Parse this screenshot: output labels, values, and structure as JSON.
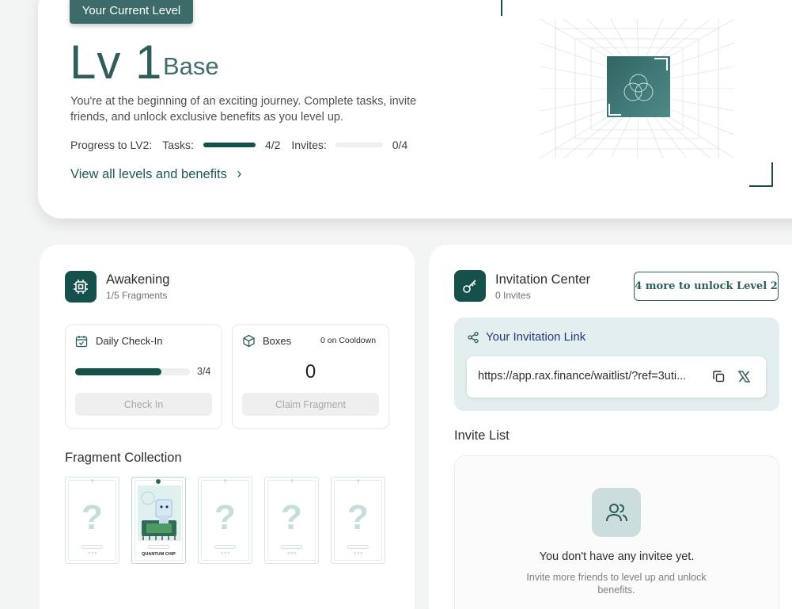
{
  "level": {
    "badge": "Your Current Level",
    "number": "Lv 1",
    "name": "Base",
    "description": "You're at the beginning of an exciting journey. Complete tasks, invite friends, and unlock exclusive benefits as you level up.",
    "progress_label": "Progress to LV2:",
    "tasks_label": "Tasks:",
    "tasks_value": "4/2",
    "tasks_fraction": 1.0,
    "invites_label": "Invites:",
    "invites_value": "0/4",
    "invites_fraction": 0.0,
    "view_link": "View all levels and benefits",
    "chevron": "›"
  },
  "awakening": {
    "title": "Awakening",
    "subtitle": "1/5 Fragments",
    "icon": "chip-icon",
    "checkin": {
      "title": "Daily Check-In",
      "progress": "3/4",
      "fraction": 0.75,
      "button": "Check In"
    },
    "boxes": {
      "title": "Boxes",
      "cooldown": "0 on Cooldown",
      "count": "0",
      "button": "Claim Fragment"
    },
    "collection_title": "Fragment Collection",
    "fragments": [
      {
        "symbol": "?",
        "top": "?",
        "caption": "? ? ?",
        "unlocked": false
      },
      {
        "symbol": "",
        "top": "",
        "caption": "QUANTUM CHIP",
        "unlocked": true
      },
      {
        "symbol": "?",
        "top": "?",
        "caption": "? ? ?",
        "unlocked": false
      },
      {
        "symbol": "?",
        "top": "?",
        "caption": "? ? ?",
        "unlocked": false
      },
      {
        "symbol": "?",
        "top": "?",
        "caption": "? ? ?",
        "unlocked": false
      }
    ]
  },
  "invitation": {
    "title": "Invitation Center",
    "subtitle": "0 Invites",
    "icon": "key-icon",
    "unlock_button": "4 more to unlock Level 2",
    "link_title": "Your Invitation Link",
    "link_url": "https://app.rax.finance/waitlist/?ref=3uti...",
    "list_title": "Invite List",
    "empty_title": "You don't have any invitee yet.",
    "empty_sub": "Invite more friends to level up and unlock benefits."
  },
  "colors": {
    "accent": "#15504a",
    "badge": "#3d6b6a",
    "link_title": "#233a7a"
  }
}
